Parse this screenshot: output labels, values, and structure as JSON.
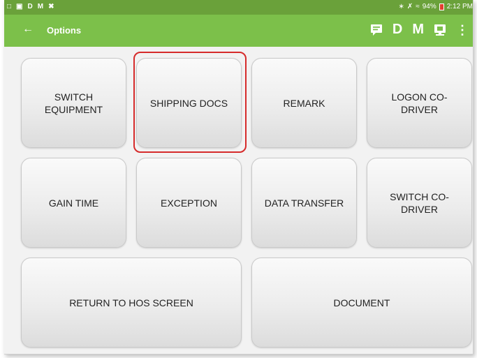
{
  "status_bar": {
    "left_icons": [
      "D",
      "M"
    ],
    "battery": "94%",
    "time": "2:12 PM"
  },
  "app_bar": {
    "back_icon": "arrow-left-icon",
    "title": "Options",
    "actions": {
      "message_icon": "chat-icon",
      "d_label": "D",
      "m_label": "M",
      "screen_icon": "monitor-icon",
      "more_icon": "more-vert-icon"
    }
  },
  "options": {
    "switch_equipment": "SWITCH EQUIPMENT",
    "shipping_docs": "SHIPPING DOCS",
    "remark": "REMARK",
    "logon_co_driver": "LOGON CO-DRIVER",
    "gain_time": "GAIN TIME",
    "exception": "EXCEPTION",
    "data_transfer": "DATA TRANSFER",
    "switch_co_driver": "SWITCH CO-DRIVER",
    "return_to_hos": "RETURN TO HOS SCREEN",
    "document": "DOCUMENT"
  },
  "colors": {
    "status_bar": "#6aa13a",
    "app_bar": "#7cc04a",
    "highlight": "#d62b2b"
  }
}
